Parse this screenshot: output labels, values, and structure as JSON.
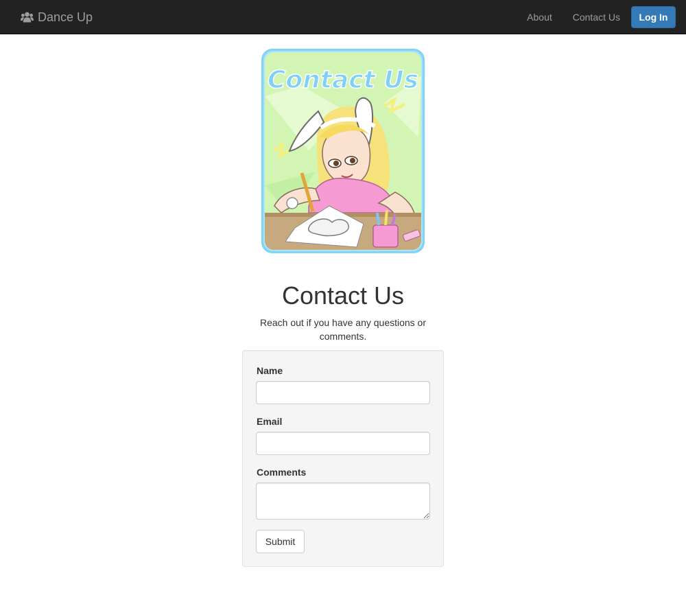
{
  "navbar": {
    "brand": {
      "icon": "users-icon",
      "label": "Dance Up"
    },
    "links": [
      {
        "label": "About"
      },
      {
        "label": "Contact Us"
      }
    ],
    "login_label": "Log In",
    "colors": {
      "bar": "#222222",
      "link": "#9d9d9d",
      "login_bg": "#337ab7"
    }
  },
  "hero": {
    "image_caption": "Contact Us"
  },
  "page": {
    "title": "Contact Us",
    "subtitle": "Reach out if you have any questions or comments."
  },
  "form": {
    "fields": [
      {
        "label": "Name",
        "value": ""
      },
      {
        "label": "Email",
        "value": ""
      },
      {
        "label": "Comments",
        "value": ""
      }
    ],
    "submit_label": "Submit"
  }
}
